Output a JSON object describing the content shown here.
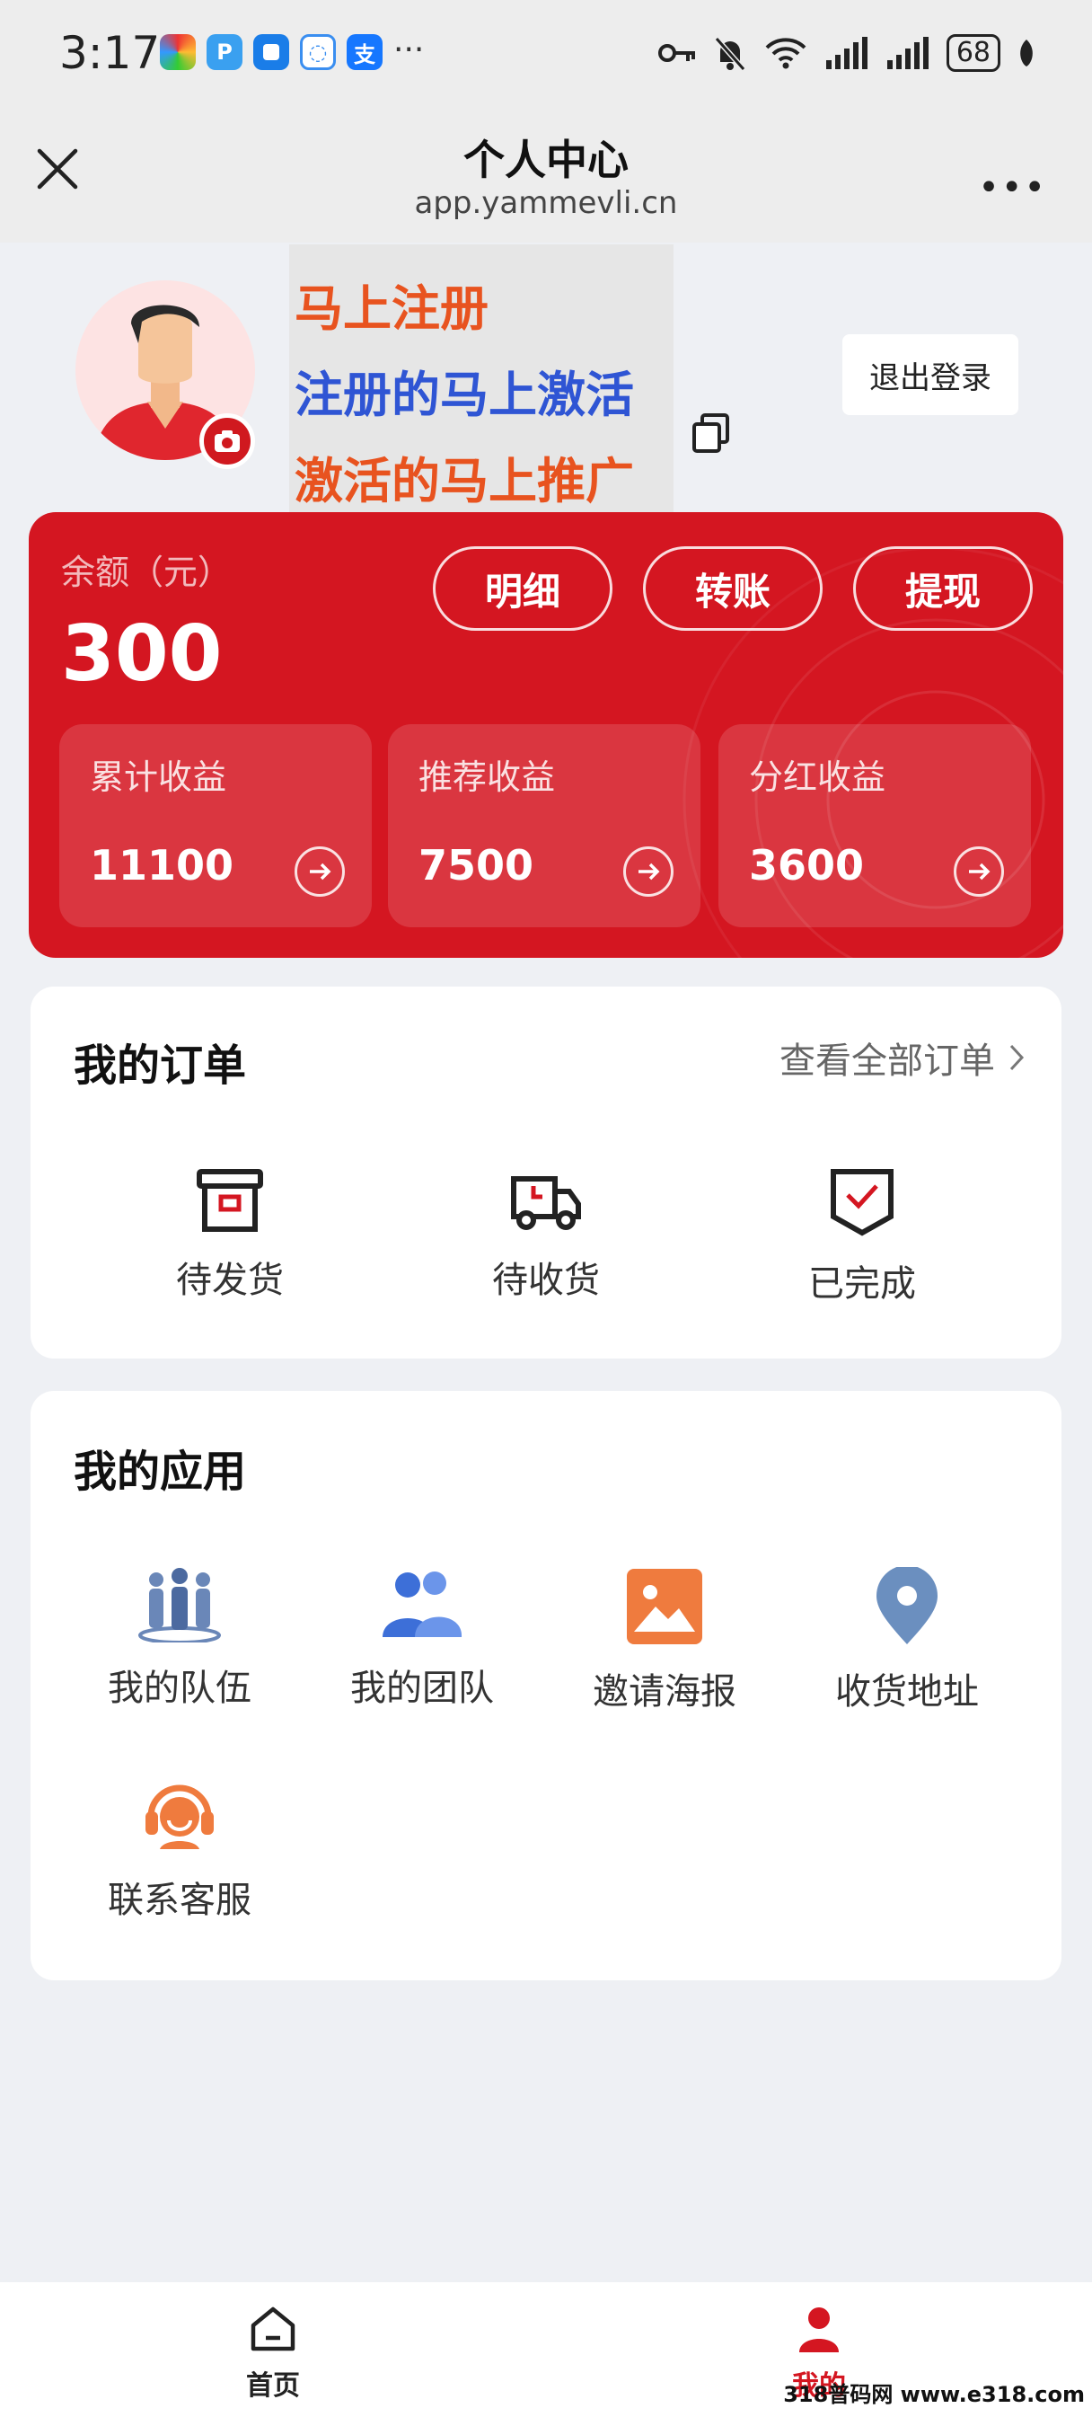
{
  "status_bar": {
    "time": "3:17",
    "more": "···",
    "battery": "68"
  },
  "navbar": {
    "title": "个人中心",
    "url": "app.yammevli.cn",
    "more": "•••"
  },
  "promo": {
    "line1": "马上注册",
    "line2": "注册的马上激活",
    "line3": "激活的马上推广",
    "colors": [
      "#e8531f",
      "#2f55d4",
      "#e8531f"
    ]
  },
  "profile": {
    "logout_label": "退出登录"
  },
  "balance": {
    "label": "余额（元）",
    "value": "300",
    "buttons": [
      "明细",
      "转账",
      "提现"
    ],
    "stats": [
      {
        "label": "累计收益",
        "value": "11100"
      },
      {
        "label": "推荐收益",
        "value": "7500"
      },
      {
        "label": "分红收益",
        "value": "3600"
      }
    ],
    "accent": "#d41621"
  },
  "orders": {
    "title": "我的订单",
    "view_all": "查看全部订单",
    "items": [
      {
        "label": "待发货",
        "icon": "box-icon"
      },
      {
        "label": "待收货",
        "icon": "truck-icon"
      },
      {
        "label": "已完成",
        "icon": "check-shield-icon"
      }
    ]
  },
  "apps": {
    "title": "我的应用",
    "items": [
      {
        "label": "我的队伍",
        "icon": "team-icon"
      },
      {
        "label": "我的团队",
        "icon": "group-icon"
      },
      {
        "label": "邀请海报",
        "icon": "poster-icon"
      },
      {
        "label": "收货地址",
        "icon": "location-icon"
      },
      {
        "label": "联系客服",
        "icon": "headset-icon"
      }
    ]
  },
  "tabbar": {
    "items": [
      {
        "label": "首页",
        "icon": "home-icon"
      },
      {
        "label": "我的",
        "icon": "user-icon"
      }
    ],
    "active_color": "#d41621"
  },
  "watermark": "318普码网 www.e318.com"
}
